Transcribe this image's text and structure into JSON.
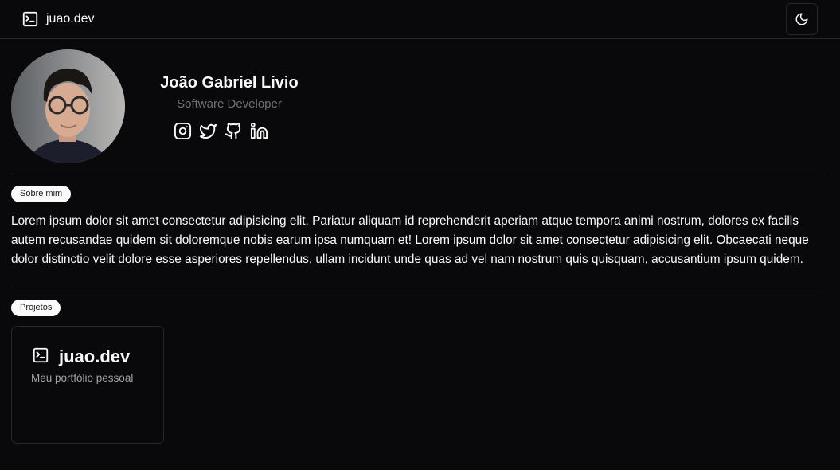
{
  "nav": {
    "brand": "juao.dev",
    "theme_toggle_icon": "moon-icon"
  },
  "profile": {
    "name": "João Gabriel Livio",
    "role": "Software Developer",
    "socials": [
      "instagram-icon",
      "twitter-icon",
      "github-icon",
      "linkedin-icon"
    ]
  },
  "about": {
    "label": "Sobre mim",
    "text": "Lorem ipsum dolor sit amet consectetur adipisicing elit. Pariatur aliquam id reprehenderit aperiam atque tempora animi nostrum, dolores ex facilis autem recusandae quidem sit doloremque nobis earum ipsa numquam et! Lorem ipsum dolor sit amet consectetur adipisicing elit. Obcaecati neque dolor distinctio velit dolore esse asperiores repellendus, ullam incidunt unde quas ad vel nam nostrum quis quisquam, accusantium ipsum quidem."
  },
  "projects": {
    "label": "Projetos",
    "items": [
      {
        "title": "juao.dev",
        "description": "Meu portfólio pessoal"
      }
    ]
  },
  "colors": {
    "background": "#09090b",
    "border": "#27272a",
    "muted_text": "#71717a",
    "pill_bg": "#fafafa"
  }
}
